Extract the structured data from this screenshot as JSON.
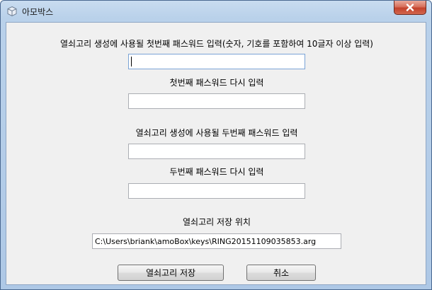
{
  "window": {
    "title": "아모박스"
  },
  "form": {
    "first_password_label": "열쇠고리 생성에 사용될 첫번째 패스워드 입력(숫자, 기호를 포함하여 10글자 이상 입력)",
    "first_password_value": "",
    "first_password_confirm_label": "첫번째 패스워드 다시 입력",
    "first_password_confirm_value": "",
    "second_password_label": "열쇠고리 생성에 사용될 두번째 패스워드 입력",
    "second_password_value": "",
    "second_password_confirm_label": "두번째 패스워드 다시 입력",
    "second_password_confirm_value": "",
    "save_location_label": "열쇠고리 저장 위치",
    "save_location_value": "C:\\Users\\briank\\amoBox\\keys\\RING20151109035853.arg"
  },
  "buttons": {
    "save_label": "열쇠고리 저장",
    "cancel_label": "취소"
  },
  "colors": {
    "titlebar": "#b9d1ea",
    "client_bg": "#f0f0f0",
    "close_button": "#c2412b",
    "field_border": "#abadb3"
  },
  "icons": {
    "app": "app-window-icon",
    "close": "close-icon"
  }
}
